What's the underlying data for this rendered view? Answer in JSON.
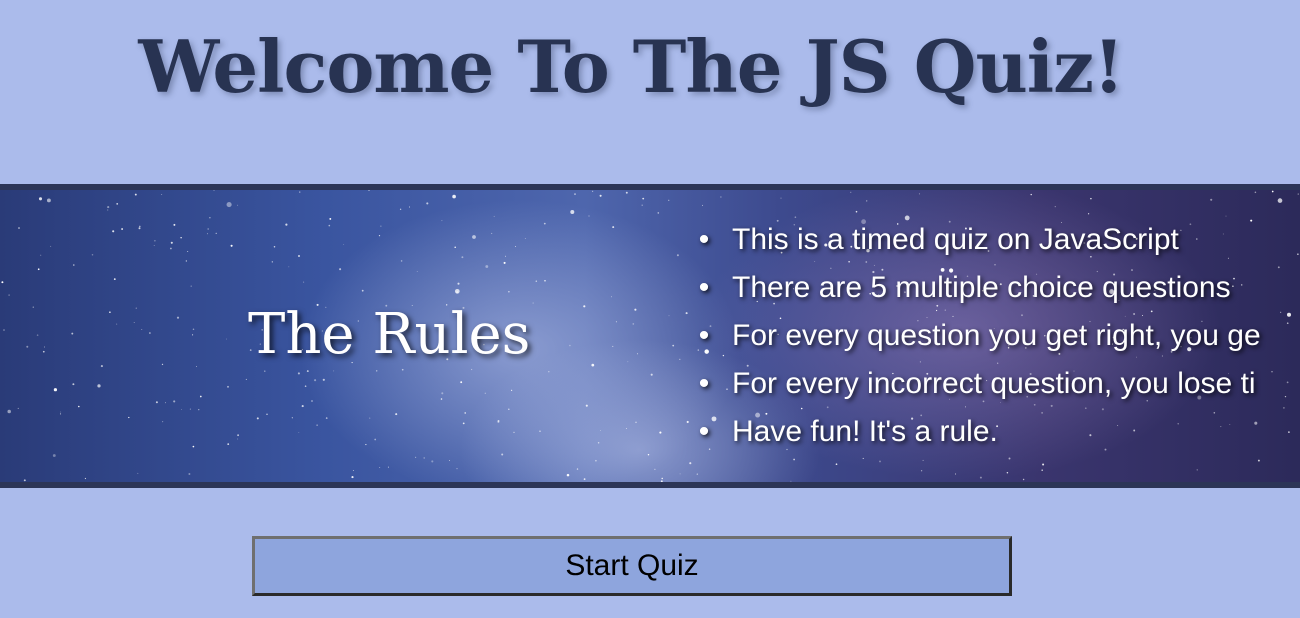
{
  "header": {
    "title": "Welcome To The JS Quiz!"
  },
  "rules": {
    "heading": "The Rules",
    "items": [
      "This is a timed quiz on JavaScript",
      "There are 5 multiple choice questions",
      "For every question you get right, you ge",
      "For every incorrect question, you lose ti",
      "Have fun! It's a rule."
    ],
    "bullet": "•"
  },
  "actions": {
    "start_label": "Start Quiz"
  },
  "colors": {
    "page_background": "#abbbeb",
    "title_text": "#283352",
    "banner_border": "#2c3557",
    "button_background": "#8ea5dd"
  },
  "icons": {
    "banner_background": "starfield-image"
  }
}
